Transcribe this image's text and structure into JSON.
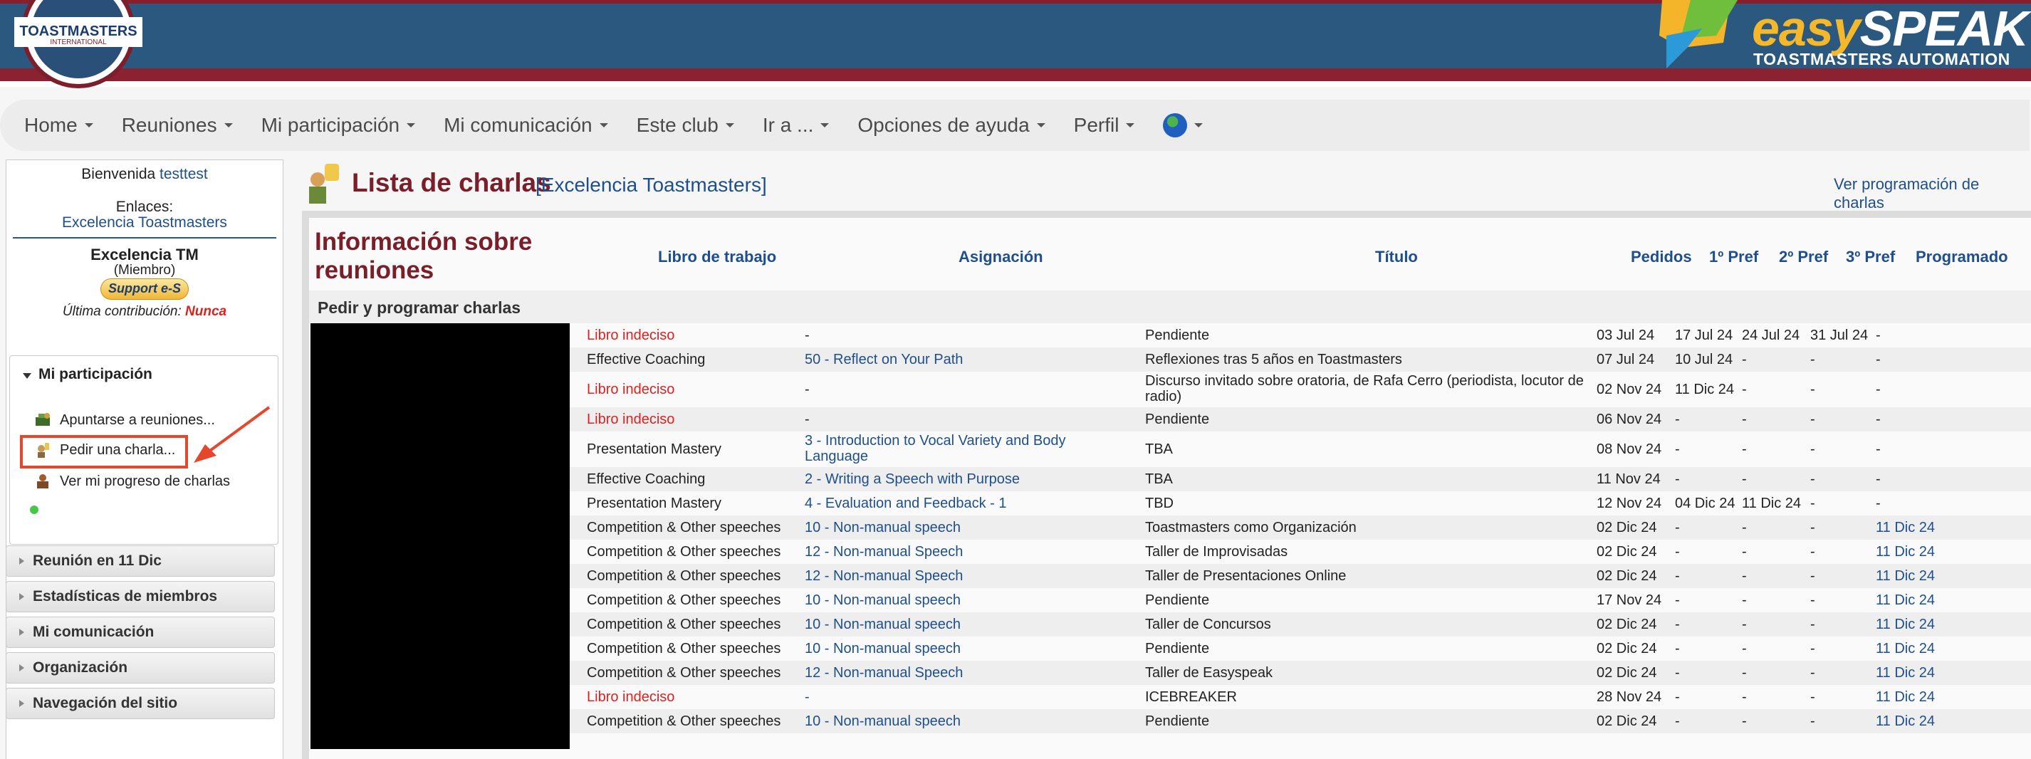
{
  "header": {
    "tm_logo_text": "TOASTMASTERS",
    "tm_logo_sub": "INTERNATIONAL",
    "brand_easy": "easy",
    "brand_speak": "SPEAK",
    "brand_subtitle": "TOASTMASTERS AUTOMATION"
  },
  "nav": {
    "items": [
      "Home",
      "Reuniones",
      "Mi participación",
      "Mi comunicación",
      "Este club",
      "Ir a ...",
      "Opciones de ayuda",
      "Perfil"
    ]
  },
  "sidebar": {
    "welcome": "Bienvenida",
    "username": "testtest",
    "links_label": "Enlaces:",
    "club_link": "Excelencia Toastmasters",
    "club_short": "Excelencia TM",
    "role": "(Miembro)",
    "support_button": "Support e-S",
    "last_contribution_label": "Última contribución:",
    "last_contribution_value": "Nunca",
    "panel_title": "Mi participación",
    "panel_items": [
      "Apuntarse a reuniones...",
      "Pedir una charla...",
      "Ver mi progreso de charlas"
    ],
    "accordion": [
      "Reunión en 11 Dic",
      "Estadísticas de miembros",
      "Mi comunicación",
      "Organización",
      "Navegación del sitio"
    ]
  },
  "main": {
    "title": "Lista de charlas",
    "club": "[Excelencia Toastmasters]",
    "schedule_link": "Ver programación de charlas",
    "info_title": "Información sobre reuniones",
    "section_label": "Pedir y programar charlas",
    "columns": {
      "workbook": "Libro de trabajo",
      "assignment": "Asignación",
      "title": "Título",
      "requested": "Pedidos",
      "pref1": "1º Pref",
      "pref2": "2º Pref",
      "pref3": "3º Pref",
      "scheduled": "Programado"
    },
    "rows": [
      {
        "book": "Libro indeciso",
        "assign": "-",
        "title": "Pendiente",
        "req": "03 Jul 24",
        "p1": "17 Jul 24",
        "p2": "24 Jul 24",
        "p3": "31 Jul 24",
        "sched": "-"
      },
      {
        "book": "Effective Coaching",
        "assign": "50 - Reflect on Your Path",
        "title": "Reflexiones tras 5 años en Toastmasters",
        "req": "07 Jul 24",
        "p1": "10 Jul 24",
        "p2": "-",
        "p3": "-",
        "sched": "-"
      },
      {
        "book": "Libro indeciso",
        "assign": "-",
        "title": "Discurso invitado sobre oratoria, de Rafa Cerro (periodista, locutor de radio)",
        "req": "02 Nov 24",
        "p1": "11 Dic 24",
        "p2": "-",
        "p3": "-",
        "sched": "-"
      },
      {
        "book": "Libro indeciso",
        "assign": "-",
        "title": "Pendiente",
        "req": "06 Nov 24",
        "p1": "-",
        "p2": "-",
        "p3": "-",
        "sched": "-"
      },
      {
        "book": "Presentation Mastery",
        "assign": "3 - Introduction to Vocal Variety and Body Language",
        "title": "TBA",
        "req": "08 Nov 24",
        "p1": "-",
        "p2": "-",
        "p3": "-",
        "sched": "-"
      },
      {
        "book": "Effective Coaching",
        "assign": "2 - Writing a Speech with Purpose",
        "title": "TBA",
        "req": "11 Nov 24",
        "p1": "-",
        "p2": "-",
        "p3": "-",
        "sched": "-"
      },
      {
        "book": "Presentation Mastery",
        "assign": "4 - Evaluation and Feedback - 1",
        "title": "TBD",
        "req": "12 Nov 24",
        "p1": "04 Dic 24",
        "p2": "11 Dic 24",
        "p3": "-",
        "sched": "-"
      },
      {
        "book": "Competition & Other speeches",
        "assign": "10 - Non-manual speech",
        "title": "Toastmasters como Organización",
        "req": "02 Dic 24",
        "p1": "-",
        "p2": "-",
        "p3": "-",
        "sched": "11 Dic 24"
      },
      {
        "book": "Competition & Other speeches",
        "assign": "12 - Non-manual Speech",
        "title": "Taller de Improvisadas",
        "req": "02 Dic 24",
        "p1": "-",
        "p2": "-",
        "p3": "-",
        "sched": "11 Dic 24"
      },
      {
        "book": "Competition & Other speeches",
        "assign": "12 - Non-manual Speech",
        "title": "Taller de Presentaciones Online",
        "req": "02 Dic 24",
        "p1": "-",
        "p2": "-",
        "p3": "-",
        "sched": "11 Dic 24"
      },
      {
        "book": "Competition & Other speeches",
        "assign": "10 - Non-manual speech",
        "title": "Pendiente",
        "req": "17 Nov 24",
        "p1": "-",
        "p2": "-",
        "p3": "-",
        "sched": "11 Dic 24"
      },
      {
        "book": "Competition & Other speeches",
        "assign": "10 - Non-manual speech",
        "title": "Taller de Concursos",
        "req": "02 Dic 24",
        "p1": "-",
        "p2": "-",
        "p3": "-",
        "sched": "11 Dic 24"
      },
      {
        "book": "Competition & Other speeches",
        "assign": "10 - Non-manual speech",
        "title": "Pendiente",
        "req": "02 Dic 24",
        "p1": "-",
        "p2": "-",
        "p3": "-",
        "sched": "11 Dic 24"
      },
      {
        "book": "Competition & Other speeches",
        "assign": "12 - Non-manual Speech",
        "title": "Taller de Easyspeak",
        "req": "02 Dic 24",
        "p1": "-",
        "p2": "-",
        "p3": "-",
        "sched": "11 Dic 24"
      },
      {
        "book": "Libro indeciso",
        "assign": "-",
        "title": "ICEBREAKER",
        "req": "28 Nov 24",
        "p1": "-",
        "p2": "-",
        "p3": "-",
        "sched": "11 Dic 24"
      },
      {
        "book": "Competition & Other speeches",
        "assign": "10 - Non-manual speech",
        "title": "Pendiente",
        "req": "02 Dic 24",
        "p1": "-",
        "p2": "-",
        "p3": "-",
        "sched": "11 Dic 24"
      }
    ]
  }
}
